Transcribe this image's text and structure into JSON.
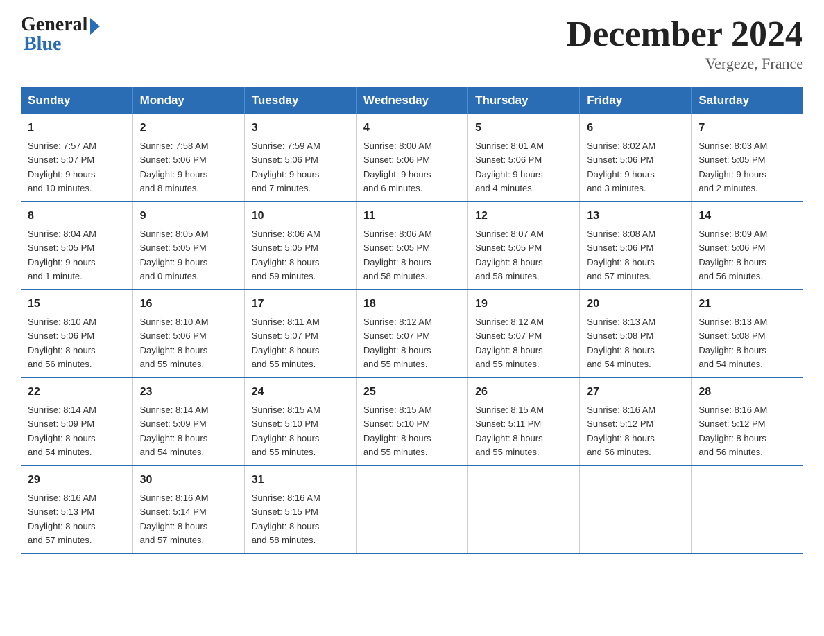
{
  "logo": {
    "general": "General",
    "blue": "Blue"
  },
  "header": {
    "month": "December 2024",
    "location": "Vergeze, France"
  },
  "weekdays": [
    "Sunday",
    "Monday",
    "Tuesday",
    "Wednesday",
    "Thursday",
    "Friday",
    "Saturday"
  ],
  "weeks": [
    [
      {
        "day": "1",
        "sunrise": "7:57 AM",
        "sunset": "5:07 PM",
        "daylight": "9 hours and 10 minutes."
      },
      {
        "day": "2",
        "sunrise": "7:58 AM",
        "sunset": "5:06 PM",
        "daylight": "9 hours and 8 minutes."
      },
      {
        "day": "3",
        "sunrise": "7:59 AM",
        "sunset": "5:06 PM",
        "daylight": "9 hours and 7 minutes."
      },
      {
        "day": "4",
        "sunrise": "8:00 AM",
        "sunset": "5:06 PM",
        "daylight": "9 hours and 6 minutes."
      },
      {
        "day": "5",
        "sunrise": "8:01 AM",
        "sunset": "5:06 PM",
        "daylight": "9 hours and 4 minutes."
      },
      {
        "day": "6",
        "sunrise": "8:02 AM",
        "sunset": "5:06 PM",
        "daylight": "9 hours and 3 minutes."
      },
      {
        "day": "7",
        "sunrise": "8:03 AM",
        "sunset": "5:05 PM",
        "daylight": "9 hours and 2 minutes."
      }
    ],
    [
      {
        "day": "8",
        "sunrise": "8:04 AM",
        "sunset": "5:05 PM",
        "daylight": "9 hours and 1 minute."
      },
      {
        "day": "9",
        "sunrise": "8:05 AM",
        "sunset": "5:05 PM",
        "daylight": "9 hours and 0 minutes."
      },
      {
        "day": "10",
        "sunrise": "8:06 AM",
        "sunset": "5:05 PM",
        "daylight": "8 hours and 59 minutes."
      },
      {
        "day": "11",
        "sunrise": "8:06 AM",
        "sunset": "5:05 PM",
        "daylight": "8 hours and 58 minutes."
      },
      {
        "day": "12",
        "sunrise": "8:07 AM",
        "sunset": "5:05 PM",
        "daylight": "8 hours and 58 minutes."
      },
      {
        "day": "13",
        "sunrise": "8:08 AM",
        "sunset": "5:06 PM",
        "daylight": "8 hours and 57 minutes."
      },
      {
        "day": "14",
        "sunrise": "8:09 AM",
        "sunset": "5:06 PM",
        "daylight": "8 hours and 56 minutes."
      }
    ],
    [
      {
        "day": "15",
        "sunrise": "8:10 AM",
        "sunset": "5:06 PM",
        "daylight": "8 hours and 56 minutes."
      },
      {
        "day": "16",
        "sunrise": "8:10 AM",
        "sunset": "5:06 PM",
        "daylight": "8 hours and 55 minutes."
      },
      {
        "day": "17",
        "sunrise": "8:11 AM",
        "sunset": "5:07 PM",
        "daylight": "8 hours and 55 minutes."
      },
      {
        "day": "18",
        "sunrise": "8:12 AM",
        "sunset": "5:07 PM",
        "daylight": "8 hours and 55 minutes."
      },
      {
        "day": "19",
        "sunrise": "8:12 AM",
        "sunset": "5:07 PM",
        "daylight": "8 hours and 55 minutes."
      },
      {
        "day": "20",
        "sunrise": "8:13 AM",
        "sunset": "5:08 PM",
        "daylight": "8 hours and 54 minutes."
      },
      {
        "day": "21",
        "sunrise": "8:13 AM",
        "sunset": "5:08 PM",
        "daylight": "8 hours and 54 minutes."
      }
    ],
    [
      {
        "day": "22",
        "sunrise": "8:14 AM",
        "sunset": "5:09 PM",
        "daylight": "8 hours and 54 minutes."
      },
      {
        "day": "23",
        "sunrise": "8:14 AM",
        "sunset": "5:09 PM",
        "daylight": "8 hours and 54 minutes."
      },
      {
        "day": "24",
        "sunrise": "8:15 AM",
        "sunset": "5:10 PM",
        "daylight": "8 hours and 55 minutes."
      },
      {
        "day": "25",
        "sunrise": "8:15 AM",
        "sunset": "5:10 PM",
        "daylight": "8 hours and 55 minutes."
      },
      {
        "day": "26",
        "sunrise": "8:15 AM",
        "sunset": "5:11 PM",
        "daylight": "8 hours and 55 minutes."
      },
      {
        "day": "27",
        "sunrise": "8:16 AM",
        "sunset": "5:12 PM",
        "daylight": "8 hours and 56 minutes."
      },
      {
        "day": "28",
        "sunrise": "8:16 AM",
        "sunset": "5:12 PM",
        "daylight": "8 hours and 56 minutes."
      }
    ],
    [
      {
        "day": "29",
        "sunrise": "8:16 AM",
        "sunset": "5:13 PM",
        "daylight": "8 hours and 57 minutes."
      },
      {
        "day": "30",
        "sunrise": "8:16 AM",
        "sunset": "5:14 PM",
        "daylight": "8 hours and 57 minutes."
      },
      {
        "day": "31",
        "sunrise": "8:16 AM",
        "sunset": "5:15 PM",
        "daylight": "8 hours and 58 minutes."
      },
      null,
      null,
      null,
      null
    ]
  ],
  "labels": {
    "sunrise": "Sunrise:",
    "sunset": "Sunset:",
    "daylight": "Daylight:"
  }
}
